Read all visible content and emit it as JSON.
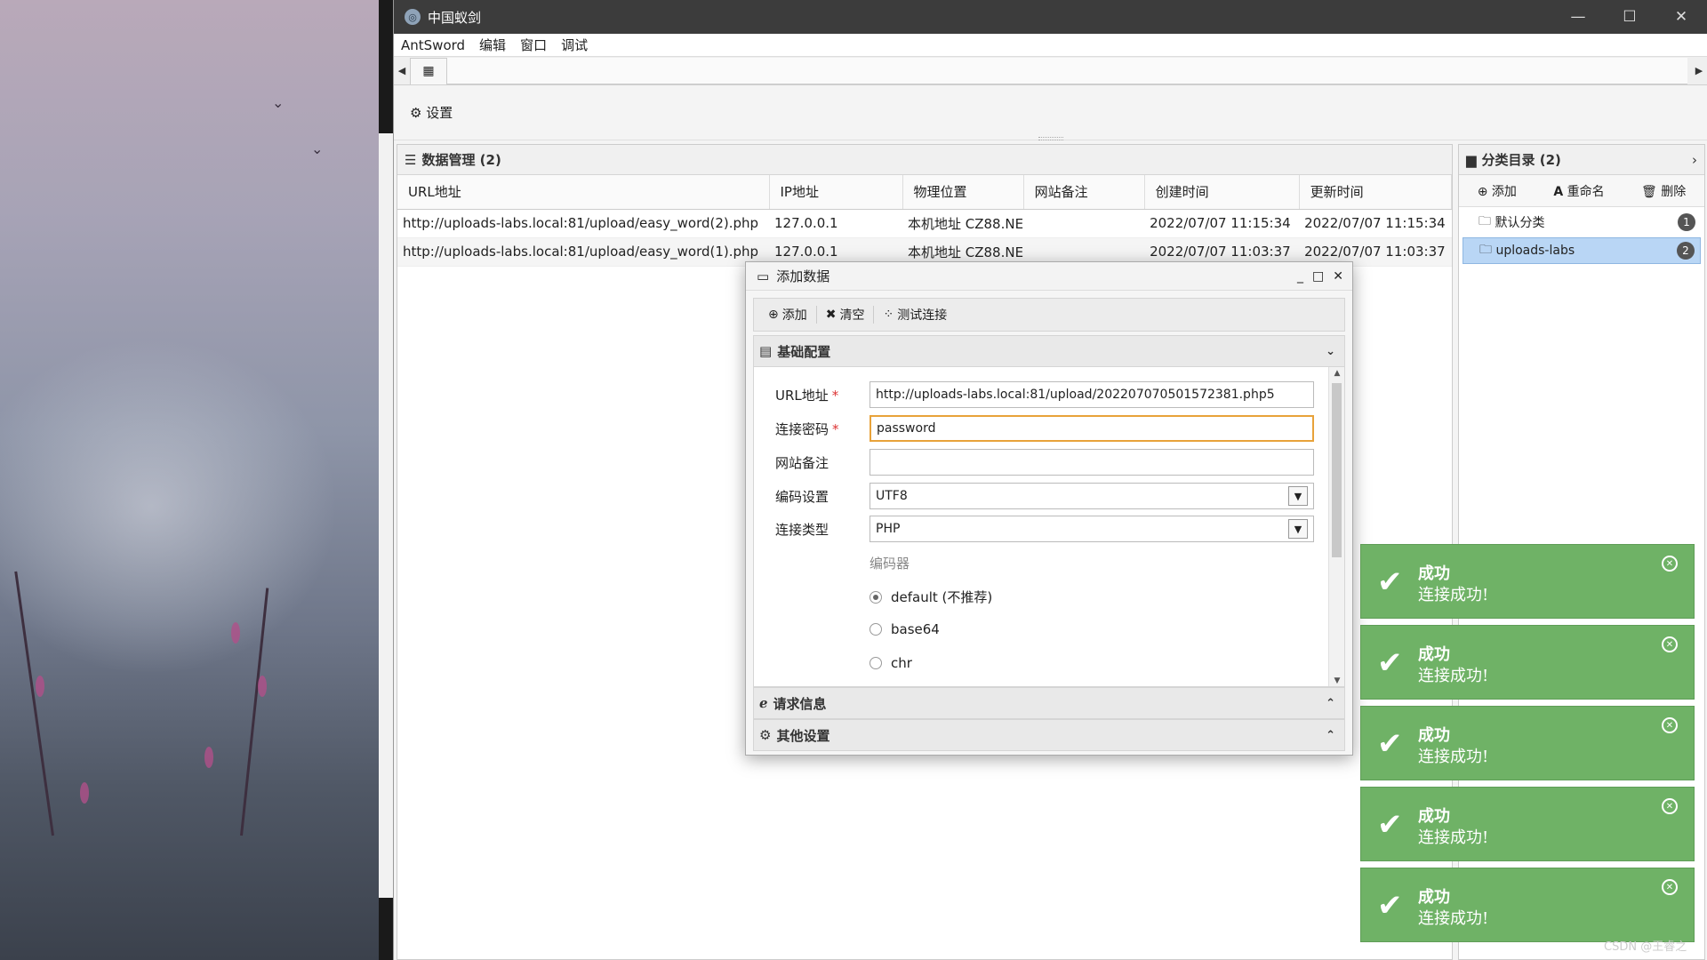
{
  "window": {
    "title": "中国蚁剑"
  },
  "menu": [
    "AntSword",
    "编辑",
    "窗口",
    "调试"
  ],
  "toolbar": {
    "settings_label": "设置"
  },
  "data_panel": {
    "title": "数据管理 (2)",
    "columns": [
      "URL地址",
      "IP地址",
      "物理位置",
      "网站备注",
      "创建时间",
      "更新时间"
    ],
    "rows": [
      [
        "http://uploads-labs.local:81/upload/easy_word(2).php",
        "127.0.0.1",
        "本机地址 CZ88.NE",
        "",
        "2022/07/07 11:15:34",
        "2022/07/07 11:15:34"
      ],
      [
        "http://uploads-labs.local:81/upload/easy_word(1).php",
        "127.0.0.1",
        "本机地址 CZ88.NE",
        "",
        "2022/07/07 11:03:37",
        "2022/07/07 11:03:37"
      ]
    ]
  },
  "category_panel": {
    "title": "分类目录 (2)",
    "tools": {
      "add": "添加",
      "rename": "重命名",
      "delete": "删除"
    },
    "items": [
      {
        "label": "默认分类",
        "count": "1"
      },
      {
        "label": "uploads-labs",
        "count": "2"
      }
    ]
  },
  "dialog": {
    "title": "添加数据",
    "toolbar": {
      "add": "添加",
      "clear": "清空",
      "test": "测试连接"
    },
    "basic_section": "基础配置",
    "fields": {
      "url_label": "URL地址",
      "url_value": "http://uploads-labs.local:81/upload/202207070501572381.php5",
      "password_label": "连接密码",
      "password_value": "password",
      "note_label": "网站备注",
      "note_value": "",
      "encoding_label": "编码设置",
      "encoding_value": "UTF8",
      "type_label": "连接类型",
      "type_value": "PHP"
    },
    "required_mark": "*",
    "encoder_label": "编码器",
    "encoders": [
      "default (不推荐)",
      "base64",
      "chr"
    ],
    "request_section": "请求信息",
    "other_section": "其他设置"
  },
  "toasts": [
    {
      "title": "成功",
      "msg": "连接成功!"
    },
    {
      "title": "成功",
      "msg": "连接成功!"
    },
    {
      "title": "成功",
      "msg": "连接成功!"
    },
    {
      "title": "成功",
      "msg": "连接成功!"
    },
    {
      "title": "成功",
      "msg": "连接成功!"
    }
  ],
  "watermark": "CSDN @王睿之",
  "colors": {
    "toast_green": "#6fb266",
    "focus_orange": "#e8a23a",
    "selected_blue": "#b9d6f5"
  }
}
